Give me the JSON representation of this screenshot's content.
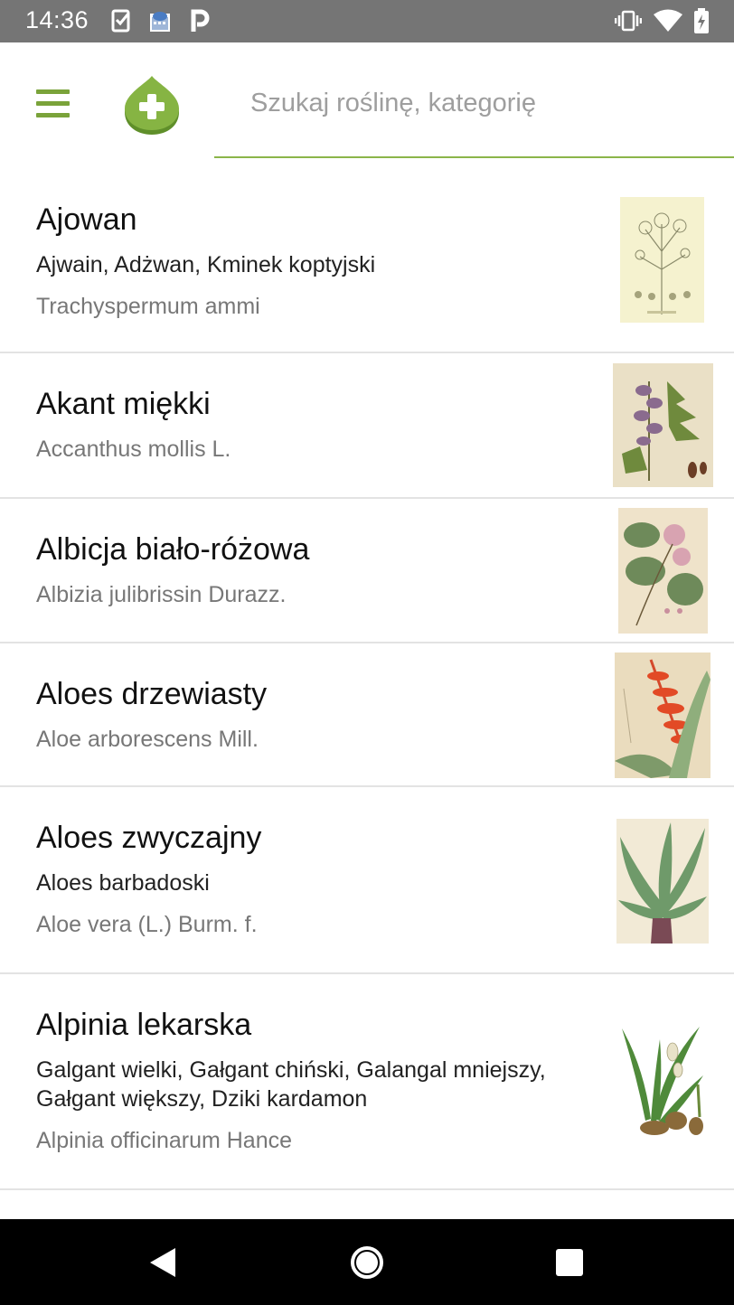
{
  "status_bar": {
    "time": "14:36",
    "left_icons": [
      "task-check-icon",
      "cloud-calendar-icon",
      "p-letter-icon"
    ],
    "right_icons": [
      "vibrate-icon",
      "wifi-icon",
      "battery-icon"
    ]
  },
  "app_bar": {
    "menu_icon": "hamburger-menu-icon",
    "add_icon": "add-plant-icon",
    "search_placeholder": "Szukaj roślinę, kategorię",
    "accent_color": "#7aa33a"
  },
  "plants": [
    {
      "name": "Ajowan",
      "alt_names": "Ajwain, Adżwan, Kminek koptyjski",
      "latin": "Trachyspermum ammi",
      "thumb_tone": "#f4f1cf"
    },
    {
      "name": "Akant miękki",
      "alt_names": "",
      "latin": "Accanthus mollis L.",
      "thumb_tone": "#e9dfc7"
    },
    {
      "name": "Albicja biało-różowa",
      "alt_names": "",
      "latin": "Albizia julibrissin Durazz.",
      "thumb_tone": "#efe2c9"
    },
    {
      "name": "Aloes drzewiasty",
      "alt_names": "",
      "latin": "Aloe arborescens Mill.",
      "thumb_tone": "#eadcbf"
    },
    {
      "name": "Aloes zwyczajny",
      "alt_names": "Aloes barbadoski",
      "latin": "Aloe vera (L.) Burm. f.",
      "thumb_tone": "#f2ead6"
    },
    {
      "name": "Alpinia lekarska",
      "alt_names": "Galgant wielki, Gałgant chiński, Galangal mniejszy, Gałgant większy, Dziki kardamon",
      "latin": "Alpinia officinarum Hance",
      "thumb_tone": "#ffffff"
    }
  ],
  "nav_bar": {
    "back_icon": "back-triangle-icon",
    "home_icon": "home-circle-icon",
    "recents_icon": "recents-square-icon"
  }
}
